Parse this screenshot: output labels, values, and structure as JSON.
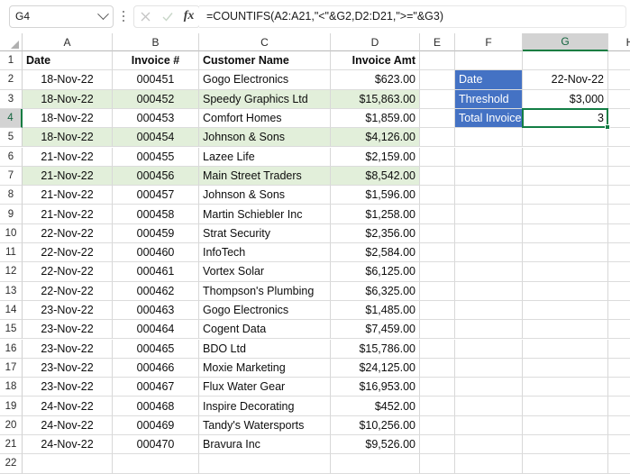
{
  "formula_bar": {
    "name_box_value": "G4",
    "name_box_icon": "chevron-down-icon",
    "options_icon": "kebab-menu-icon",
    "cancel_icon": "cancel-x-icon",
    "confirm_icon": "confirm-check-icon",
    "function_icon_label": "fx",
    "formula": "=COUNTIFS(A2:A21,\"<\"&G2,D2:D21,\">=\"&G3)"
  },
  "grid": {
    "column_headers": [
      "A",
      "B",
      "C",
      "D",
      "E",
      "F",
      "G",
      "H"
    ],
    "selected_column": "G",
    "selected_row": "4",
    "active_cell": "G4",
    "row_numbers": [
      "1",
      "2",
      "3",
      "4",
      "5",
      "6",
      "7",
      "8",
      "9",
      "10",
      "11",
      "12",
      "13",
      "14",
      "15",
      "16",
      "17",
      "18",
      "19",
      "20",
      "21",
      "22"
    ],
    "headers": {
      "a": "Date",
      "b": "Invoice #",
      "c": "Customer Name",
      "d": "Invoice Amt"
    },
    "rows": [
      {
        "n": "2",
        "date": "18-Nov-22",
        "invoice": "000451",
        "customer": "Gogo Electronics",
        "amount": "$623.00",
        "band": false
      },
      {
        "n": "3",
        "date": "18-Nov-22",
        "invoice": "000452",
        "customer": "Speedy Graphics Ltd",
        "amount": "$15,863.00",
        "band": true
      },
      {
        "n": "4",
        "date": "18-Nov-22",
        "invoice": "000453",
        "customer": "Comfort Homes",
        "amount": "$1,859.00",
        "band": false
      },
      {
        "n": "5",
        "date": "18-Nov-22",
        "invoice": "000454",
        "customer": "Johnson & Sons",
        "amount": "$4,126.00",
        "band": true
      },
      {
        "n": "6",
        "date": "21-Nov-22",
        "invoice": "000455",
        "customer": "Lazee Life",
        "amount": "$2,159.00",
        "band": false
      },
      {
        "n": "7",
        "date": "21-Nov-22",
        "invoice": "000456",
        "customer": "Main Street Traders",
        "amount": "$8,542.00",
        "band": true
      },
      {
        "n": "8",
        "date": "21-Nov-22",
        "invoice": "000457",
        "customer": "Johnson & Sons",
        "amount": "$1,596.00",
        "band": false
      },
      {
        "n": "9",
        "date": "21-Nov-22",
        "invoice": "000458",
        "customer": "Martin Schiebler Inc",
        "amount": "$1,258.00",
        "band": false
      },
      {
        "n": "10",
        "date": "22-Nov-22",
        "invoice": "000459",
        "customer": "Strat Security",
        "amount": "$2,356.00",
        "band": false
      },
      {
        "n": "11",
        "date": "22-Nov-22",
        "invoice": "000460",
        "customer": "InfoTech",
        "amount": "$2,584.00",
        "band": false
      },
      {
        "n": "12",
        "date": "22-Nov-22",
        "invoice": "000461",
        "customer": "Vortex Solar",
        "amount": "$6,125.00",
        "band": false
      },
      {
        "n": "13",
        "date": "22-Nov-22",
        "invoice": "000462",
        "customer": "Thompson's Plumbing",
        "amount": "$6,325.00",
        "band": false
      },
      {
        "n": "14",
        "date": "23-Nov-22",
        "invoice": "000463",
        "customer": "Gogo Electronics",
        "amount": "$1,485.00",
        "band": false
      },
      {
        "n": "15",
        "date": "23-Nov-22",
        "invoice": "000464",
        "customer": "Cogent Data",
        "amount": "$7,459.00",
        "band": false
      },
      {
        "n": "16",
        "date": "23-Nov-22",
        "invoice": "000465",
        "customer": "BDO Ltd",
        "amount": "$15,786.00",
        "band": false
      },
      {
        "n": "17",
        "date": "23-Nov-22",
        "invoice": "000466",
        "customer": "Moxie Marketing",
        "amount": "$24,125.00",
        "band": false
      },
      {
        "n": "18",
        "date": "23-Nov-22",
        "invoice": "000467",
        "customer": "Flux Water Gear",
        "amount": "$16,953.00",
        "band": false
      },
      {
        "n": "19",
        "date": "24-Nov-22",
        "invoice": "000468",
        "customer": "Inspire Decorating",
        "amount": "$452.00",
        "band": false
      },
      {
        "n": "20",
        "date": "24-Nov-22",
        "invoice": "000469",
        "customer": "Tandy's Watersports",
        "amount": "$10,256.00",
        "band": false
      },
      {
        "n": "21",
        "date": "24-Nov-22",
        "invoice": "000470",
        "customer": "Bravura Inc",
        "amount": "$9,526.00",
        "band": false
      }
    ]
  },
  "criteria_panel": {
    "rows": [
      {
        "label": "Date",
        "value": "22-Nov-22"
      },
      {
        "label": "Threshold",
        "value": "$3,000"
      },
      {
        "label": "Total Invoices",
        "value": "3"
      }
    ]
  },
  "colors": {
    "label_fill": "#4472C4",
    "label_text": "#FFFFFF",
    "band_fill": "#E2EFDA",
    "selection_green": "#137E45",
    "header_selected_fill": "#D3D3D3"
  }
}
